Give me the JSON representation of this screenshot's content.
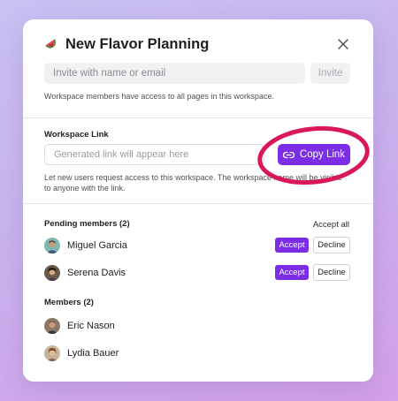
{
  "dialog": {
    "title": "New Flavor Planning",
    "title_icon": "watermelon-icon",
    "close_icon": "close-icon"
  },
  "invite": {
    "placeholder": "Invite with name or email",
    "button_label": "Invite",
    "note": "Workspace members have access to all pages in this workspace."
  },
  "workspace_link": {
    "label": "Workspace Link",
    "placeholder": "Generated link will appear here",
    "copy_button_label": "Copy Link",
    "copy_icon": "link-icon",
    "note": "Let new users request access to this workspace. The workspace name will be visible to anyone with the link."
  },
  "pending": {
    "title": "Pending members (2)",
    "accept_all_label": "Accept all",
    "accept_label": "Accept",
    "decline_label": "Decline",
    "members": [
      {
        "name": "Miguel Garcia"
      },
      {
        "name": "Serena Davis"
      }
    ]
  },
  "members": {
    "title": "Members (2)",
    "list": [
      {
        "name": "Eric Nason"
      },
      {
        "name": "Lydia Bauer"
      }
    ]
  },
  "colors": {
    "accent": "#7c2ee6",
    "highlight_circle": "#d8185a",
    "background_start": "#c9c2f3",
    "background_end": "#d4a0e8"
  }
}
